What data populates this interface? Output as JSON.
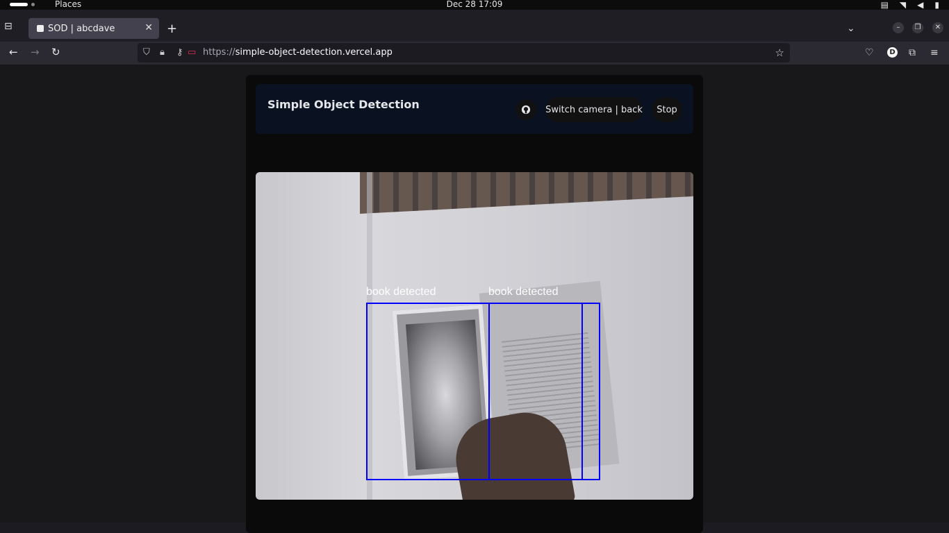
{
  "system_bar": {
    "places_label": "Places",
    "clock": "Dec 28  17:09"
  },
  "browser": {
    "tab_title": "SOD | abcdave",
    "url_scheme": "https://",
    "url_host": "simple-object-detection.vercel.app",
    "avatar_letter": "D"
  },
  "app": {
    "title": "Simple Object Detection",
    "switch_camera_label": "Switch camera | back",
    "stop_label": "Stop",
    "detections": [
      {
        "label": "book detected"
      },
      {
        "label": "book detected"
      }
    ]
  },
  "colors": {
    "bbox": "#0000ff",
    "header_bg": "#0a1120"
  }
}
